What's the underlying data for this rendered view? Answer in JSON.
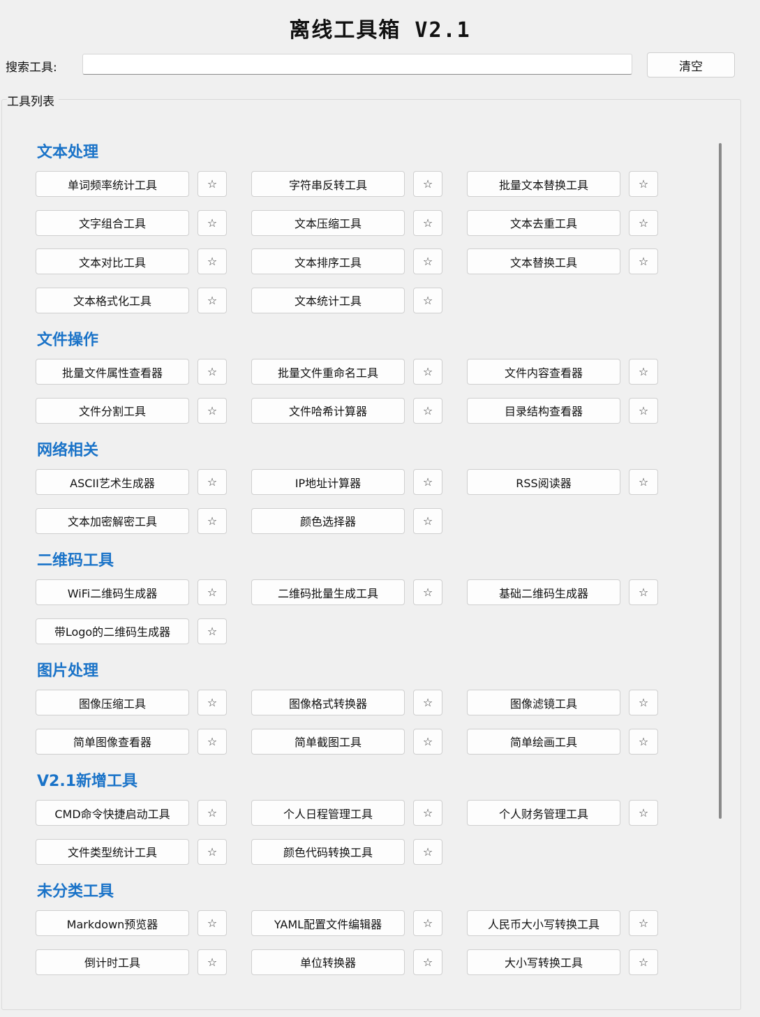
{
  "window": {
    "title": "离线工具箱 V2.1"
  },
  "search": {
    "label": "搜索工具:",
    "value": "",
    "placeholder": "",
    "clear_label": "清空"
  },
  "tool_list": {
    "label": "工具列表",
    "favorite_icon": "☆",
    "categories": [
      {
        "title": "文本处理",
        "tools": [
          "单词频率统计工具",
          "字符串反转工具",
          "批量文本替换工具",
          "文字组合工具",
          "文本压缩工具",
          "文本去重工具",
          "文本对比工具",
          "文本排序工具",
          "文本替换工具",
          "文本格式化工具",
          "文本统计工具"
        ]
      },
      {
        "title": "文件操作",
        "tools": [
          "批量文件属性查看器",
          "批量文件重命名工具",
          "文件内容查看器",
          "文件分割工具",
          "文件哈希计算器",
          "目录结构查看器"
        ]
      },
      {
        "title": "网络相关",
        "tools": [
          "ASCII艺术生成器",
          "IP地址计算器",
          "RSS阅读器",
          "文本加密解密工具",
          "颜色选择器"
        ]
      },
      {
        "title": "二维码工具",
        "tools": [
          "WiFi二维码生成器",
          "二维码批量生成工具",
          "基础二维码生成器",
          "带Logo的二维码生成器"
        ]
      },
      {
        "title": "图片处理",
        "tools": [
          "图像压缩工具",
          "图像格式转换器",
          "图像滤镜工具",
          "简单图像查看器",
          "简单截图工具",
          "简单绘画工具"
        ]
      },
      {
        "title": "V2.1新增工具",
        "tools": [
          "CMD命令快捷启动工具",
          "个人日程管理工具",
          "个人财务管理工具",
          "文件类型统计工具",
          "颜色代码转换工具"
        ]
      },
      {
        "title": "未分类工具",
        "tools": [
          "Markdown预览器",
          "YAML配置文件编辑器",
          "人民币大小写转换工具",
          "倒计时工具",
          "单位转换器",
          "大小写转换工具"
        ]
      }
    ]
  }
}
